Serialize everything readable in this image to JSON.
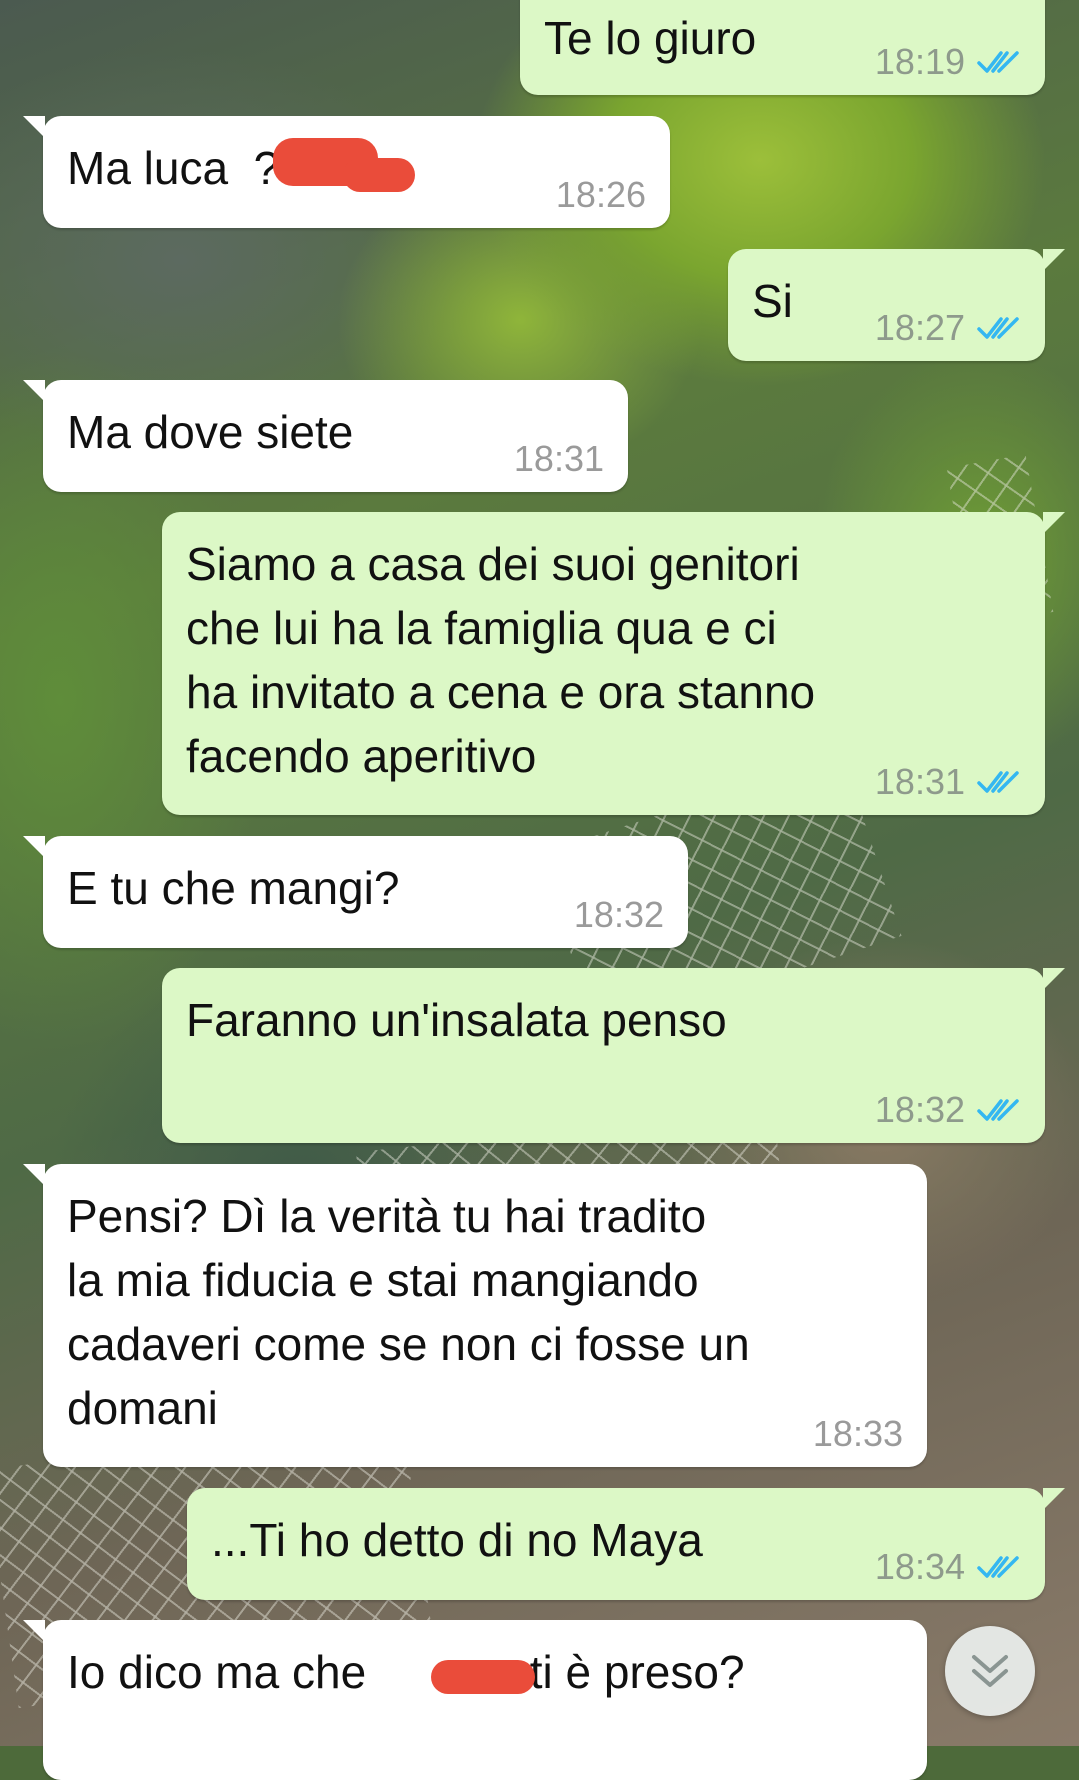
{
  "chat": {
    "messages": [
      {
        "id": "m1",
        "direction": "outgoing",
        "text": "Te lo giuro",
        "time": "18:19",
        "status": "read"
      },
      {
        "id": "m2",
        "direction": "incoming",
        "text": "Ma luca  ?",
        "time": "18:26",
        "redacted": true
      },
      {
        "id": "m3",
        "direction": "outgoing",
        "text": "Si",
        "time": "18:27",
        "status": "read"
      },
      {
        "id": "m4",
        "direction": "incoming",
        "text": "Ma dove siete",
        "time": "18:31"
      },
      {
        "id": "m5",
        "direction": "outgoing",
        "text": "Siamo a casa dei suoi genitori\nche lui ha la famiglia qua e ci\nha invitato a cena e ora stanno\nfacendo aperitivo",
        "time": "18:31",
        "status": "read"
      },
      {
        "id": "m6",
        "direction": "incoming",
        "text": "E tu che mangi?",
        "time": "18:32"
      },
      {
        "id": "m7",
        "direction": "outgoing",
        "text": "Faranno un'insalata penso",
        "time": "18:32",
        "status": "read"
      },
      {
        "id": "m8",
        "direction": "incoming",
        "text": "Pensi? Dì la verità tu hai tradito\nla mia fiducia e stai mangiando\ncadaveri come se non ci fosse un\ndomani",
        "time": "18:33"
      },
      {
        "id": "m9",
        "direction": "outgoing",
        "text": "...Ti ho detto di no Maya",
        "time": "18:34",
        "status": "read"
      },
      {
        "id": "m10",
        "direction": "incoming",
        "text": "Io dico ma che        zo ti è preso?",
        "time": "",
        "redacted": true
      }
    ]
  },
  "colors": {
    "incoming_bubble": "#ffffff",
    "outgoing_bubble": "#dcf8c6",
    "read_ticks": "#34b7f1",
    "redaction": "#ea4c3a"
  },
  "icons": {
    "read_receipt": "double-check-icon",
    "scroll_down": "chevron-double-down-icon"
  }
}
